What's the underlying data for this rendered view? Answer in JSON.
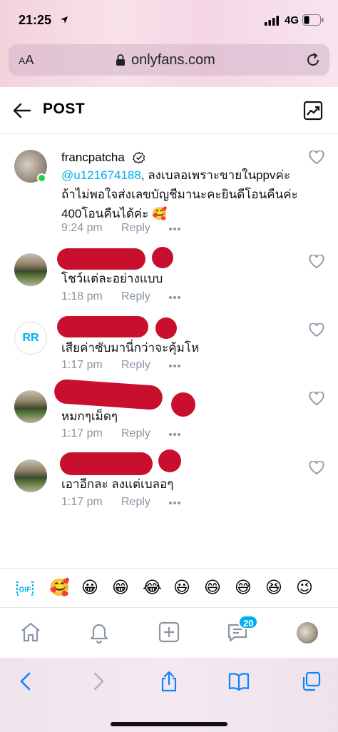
{
  "status_bar": {
    "time": "21:25",
    "network": "4G"
  },
  "browser": {
    "aa_big": "A",
    "aa_small": "A",
    "url": "onlyfans.com"
  },
  "header": {
    "title": "POST"
  },
  "comments": [
    {
      "name": "francpatcha",
      "mention": "@u121674188",
      "text": ", ลงเบลอเพราะขายในppvค่ะ ถ้าไม่พอใจส่งเลขบัญชีมานะคะยินดีโอนคืนค่ะ 400โอนคืนได้ค่ะ 🥰",
      "time": "9:24 pm",
      "reply": "Reply"
    },
    {
      "text": "โชว์แต่ละอย่างแบบ",
      "time": "1:18 pm",
      "reply": "Reply"
    },
    {
      "avatar_initials": "RR",
      "text": "เสียค่าซับมานี่กว่าจะคุ้มโห",
      "time": "1:17 pm",
      "reply": "Reply"
    },
    {
      "text": "หมกๆเม็ดๆ",
      "time": "1:17 pm",
      "reply": "Reply"
    },
    {
      "text": "เอาอีกละ ลงแต่เบลอๆ",
      "time": "1:17 pm",
      "reply": "Reply"
    }
  ],
  "emoji_bar": {
    "gif_label": "GIF",
    "emojis": [
      "🥰",
      "😀",
      "😁",
      "😂",
      "😃",
      "😄",
      "😅",
      "😆",
      "😉"
    ]
  },
  "app_nav": {
    "messages_badge": "20"
  },
  "colors": {
    "accent": "#00aff0",
    "meta": "#8a96a3",
    "redaction": "#c8102e",
    "online": "#2ecc40"
  },
  "icons": [
    "location-arrow-icon",
    "signal-icon",
    "battery-icon",
    "lock-icon",
    "reload-icon",
    "back-arrow-icon",
    "statistics-icon",
    "verified-icon",
    "heart-icon",
    "more-dots-icon",
    "gif-icon",
    "home-icon",
    "bell-icon",
    "add-post-icon",
    "messages-icon",
    "share-icon",
    "bookmarks-icon",
    "tabs-icon"
  ]
}
